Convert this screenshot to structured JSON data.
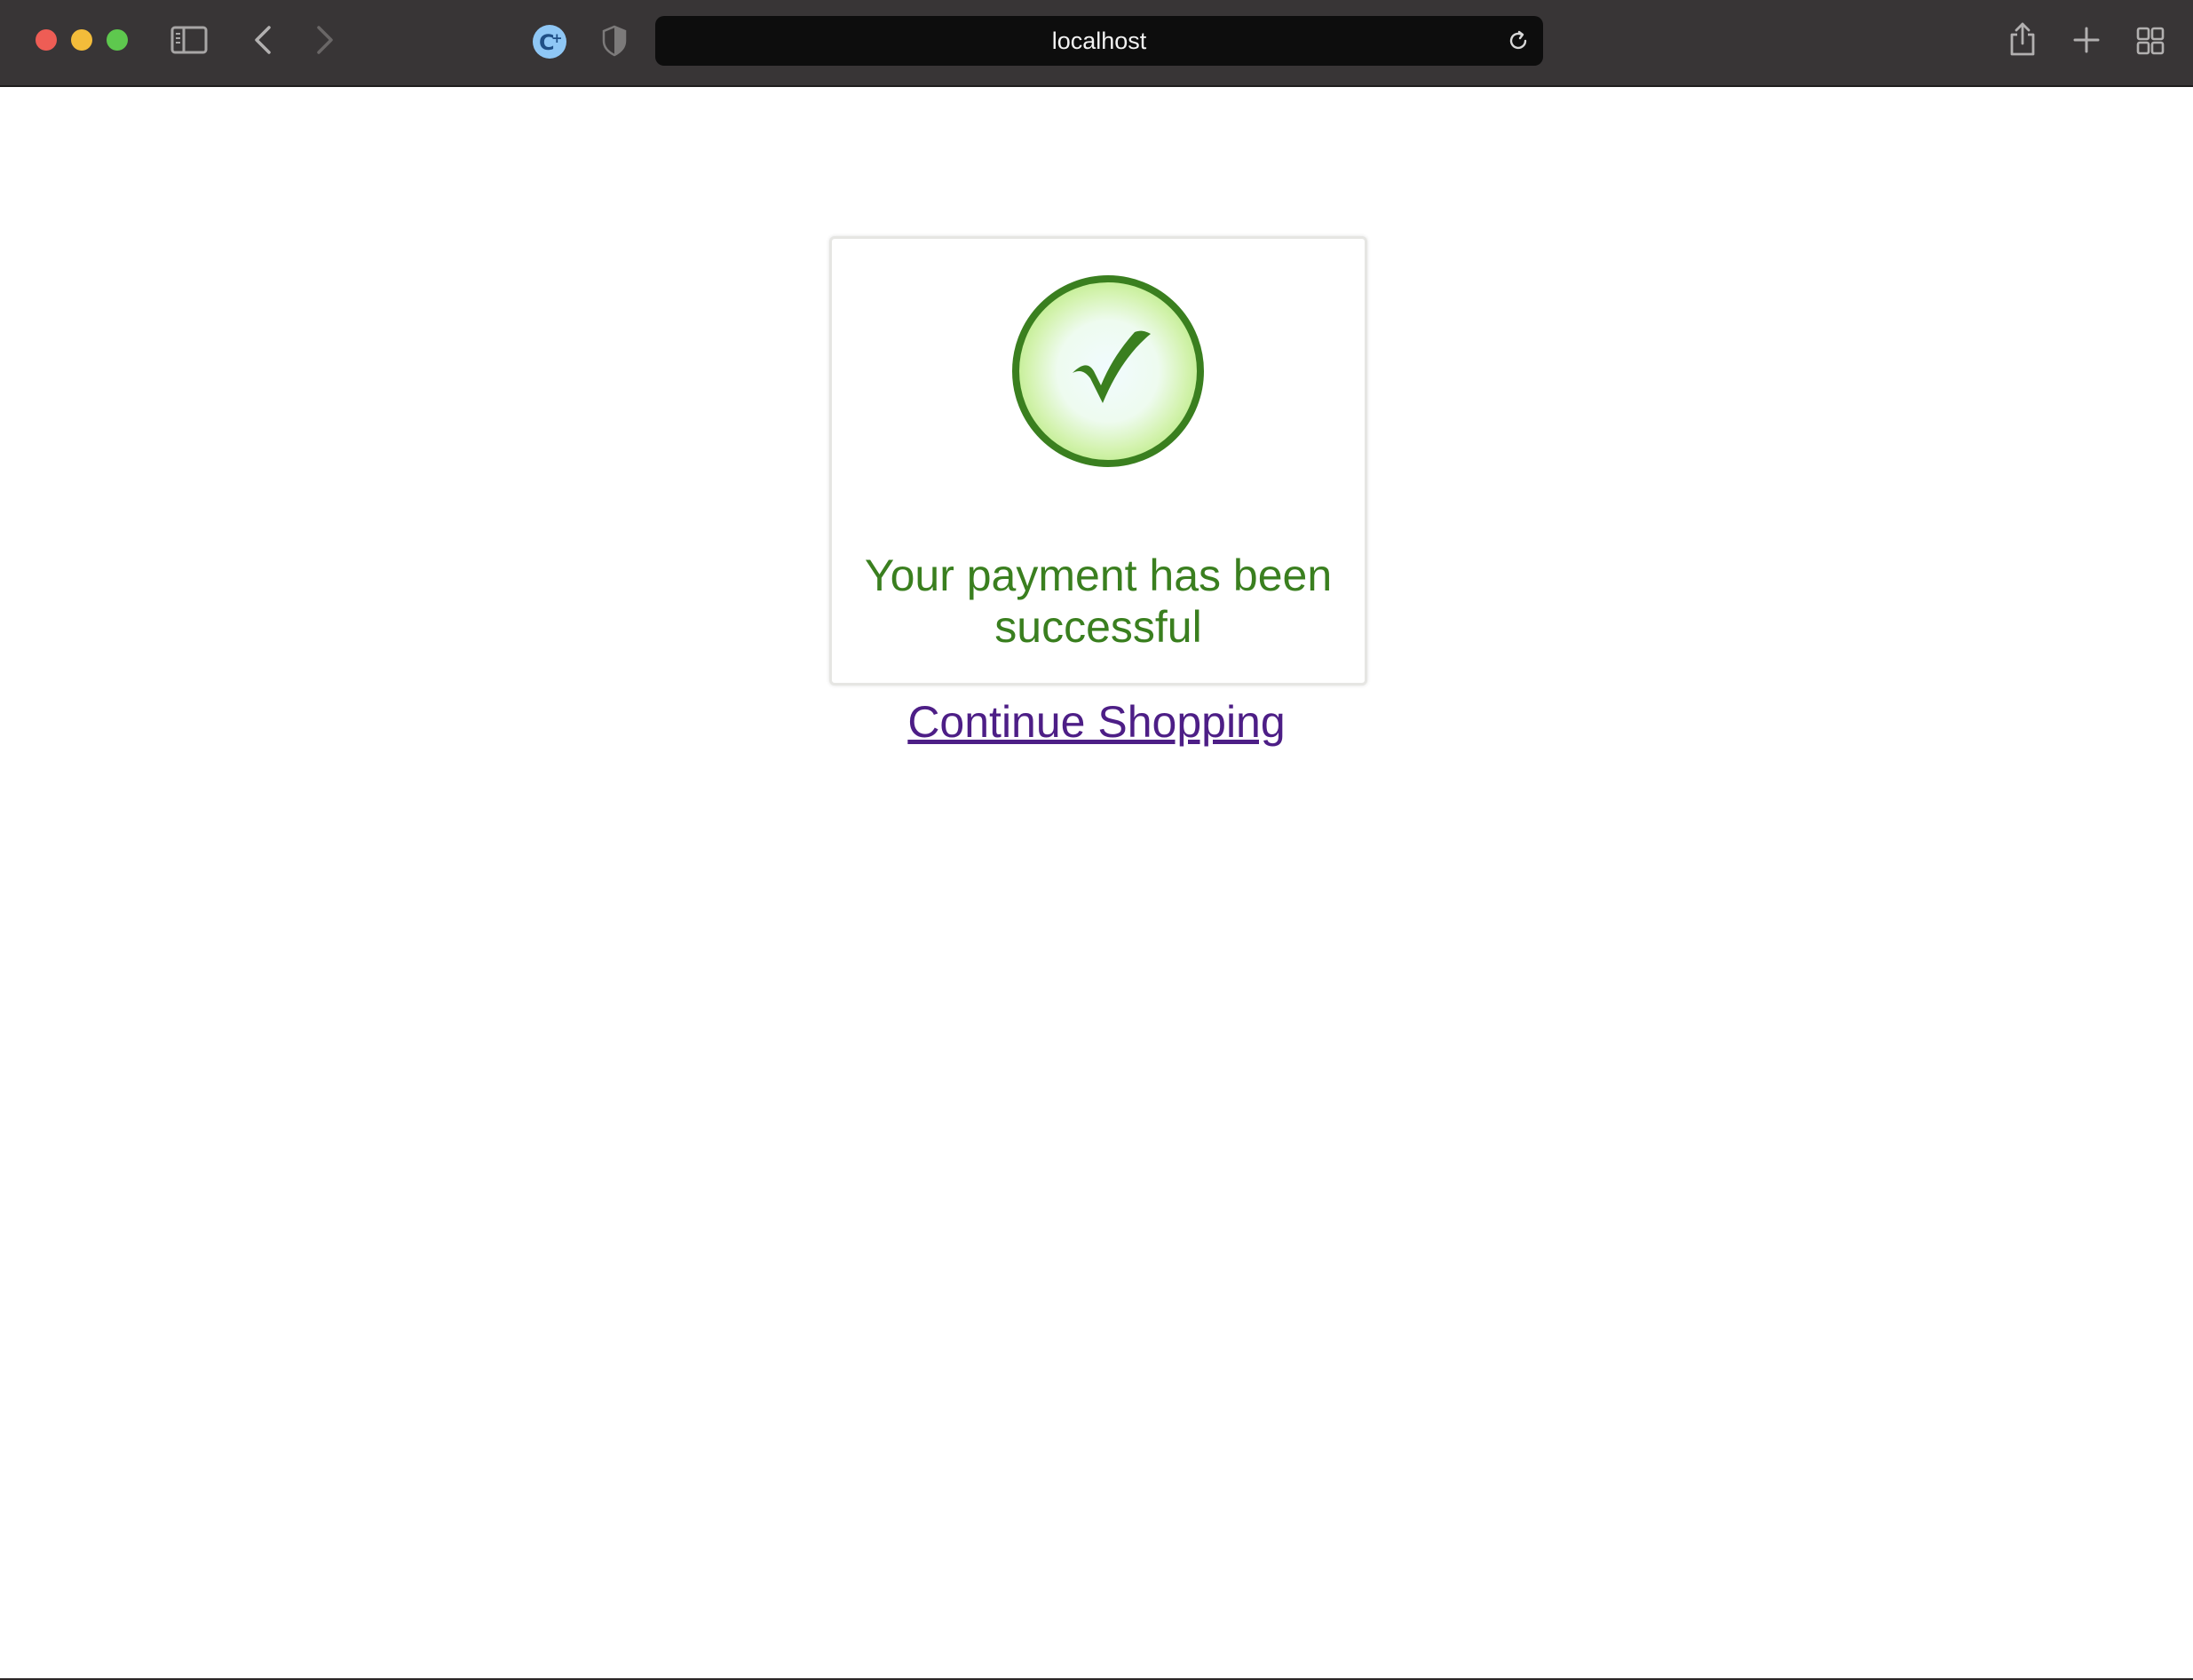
{
  "browser": {
    "address_text": "localhost",
    "icons": {
      "sidebar_toggle": "sidebar-icon",
      "back": "chevron-left-icon",
      "forward": "chevron-right-icon",
      "extension": "extension-icon",
      "privacy": "shield-icon",
      "reload": "reload-icon",
      "share": "share-icon",
      "new_tab": "plus-icon",
      "tab_overview": "grid-icon"
    },
    "colors": {
      "toolbar": "#383536",
      "address_bar": "#0d0d0d",
      "close": "#ee5d55",
      "minimize": "#f3bc3a",
      "maximize": "#5ec84e"
    }
  },
  "main": {
    "success_message": "Your payment has been successful",
    "continue_link": "Continue Shopping",
    "icon": "check-circle-icon",
    "colors": {
      "success_green": "#3a7f1f",
      "link_purple": "#4d1e86"
    }
  }
}
